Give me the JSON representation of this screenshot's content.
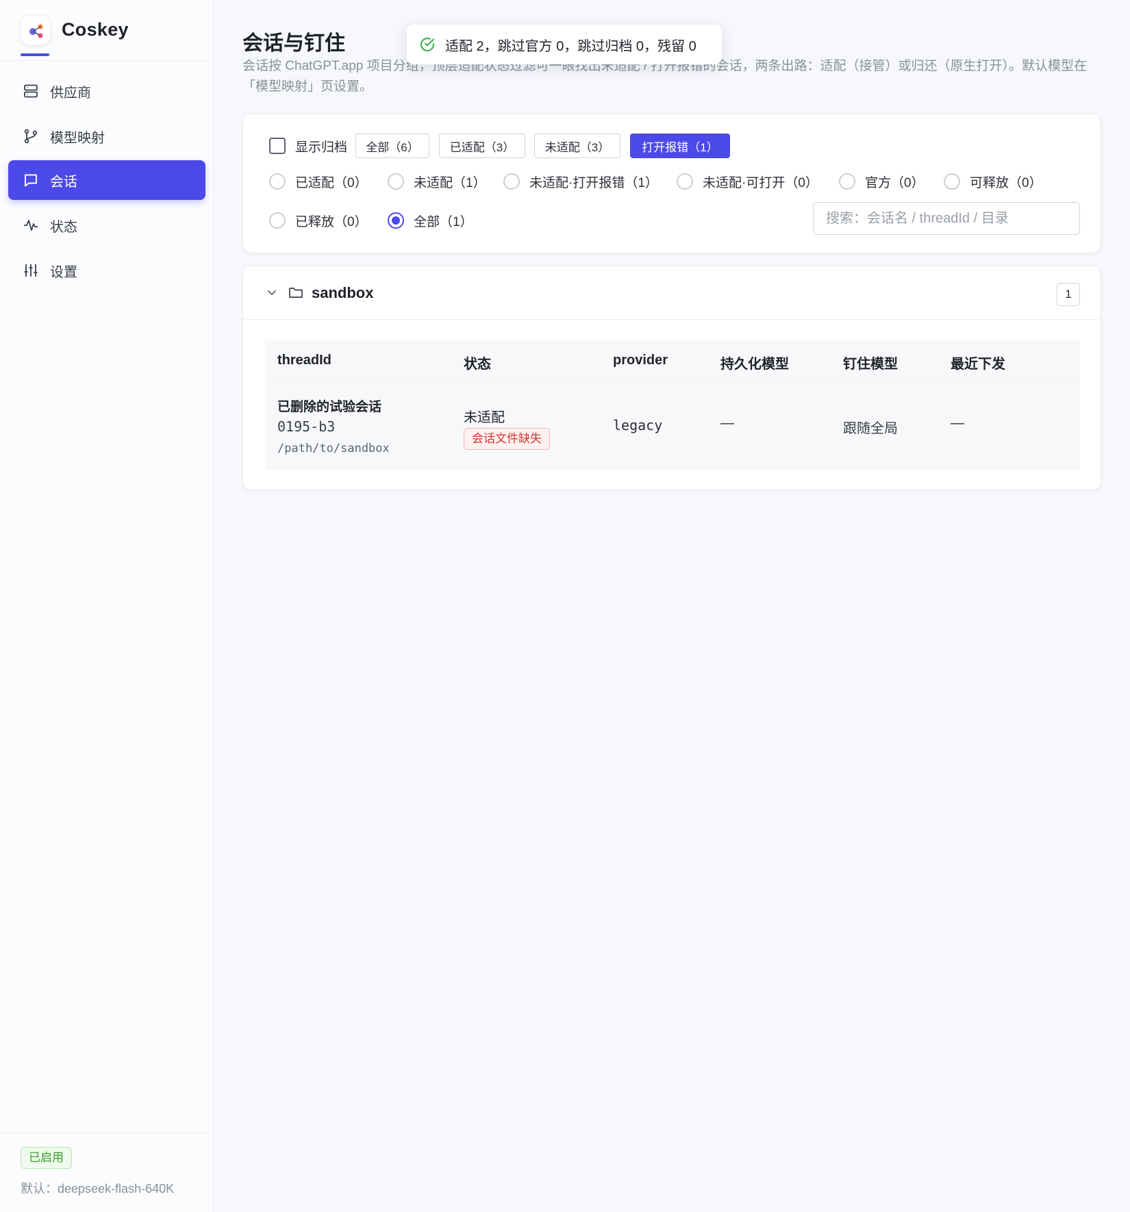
{
  "app": {
    "name": "Coskey"
  },
  "sidebar": {
    "items": [
      {
        "label": "供应商",
        "icon": "server-icon",
        "active": false
      },
      {
        "label": "模型映射",
        "icon": "branch-icon",
        "active": false
      },
      {
        "label": "会话",
        "icon": "message-icon",
        "active": true
      },
      {
        "label": "状态",
        "icon": "activity-icon",
        "active": false
      },
      {
        "label": "设置",
        "icon": "sliders-icon",
        "active": false
      }
    ],
    "footer": {
      "enabled_badge": "已启用",
      "default_model": "默认：deepseek-flash-640K"
    }
  },
  "toast": {
    "icon": "check-circle-icon",
    "message": "适配 2，跳过官方 0，跳过归档 0，残留 0"
  },
  "page": {
    "title": "会话与钉住",
    "description": "会话按 ChatGPT.app 项目分组，顶层适配状态过滤可一眼找出未适配 / 打开报错的会话，两条出路：适配（接管）或归还（原生打开）。默认模型在「模型映射」页设置。"
  },
  "filters": {
    "show_archived_label": "显示归档",
    "show_archived_checked": false,
    "chips": [
      {
        "label": "全部（6）",
        "active": false
      },
      {
        "label": "已适配（3）",
        "active": false
      },
      {
        "label": "未适配（3）",
        "active": false
      },
      {
        "label": "打开报错（1）",
        "active": true
      }
    ],
    "radios": [
      {
        "label": "已适配（0）",
        "checked": false
      },
      {
        "label": "未适配（1）",
        "checked": false
      },
      {
        "label": "未适配·打开报错（1）",
        "checked": false
      },
      {
        "label": "未适配·可打开（0）",
        "checked": false
      },
      {
        "label": "官方（0）",
        "checked": false
      },
      {
        "label": "可释放（0）",
        "checked": false
      },
      {
        "label": "已释放（0）",
        "checked": false
      },
      {
        "label": "全部（1）",
        "checked": true
      }
    ],
    "search_placeholder": "搜索：会话名 / threadId / 目录",
    "search_value": ""
  },
  "group": {
    "name": "sandbox",
    "count": "1",
    "expanded": true,
    "columns": [
      "threadId",
      "状态",
      "provider",
      "持久化模型",
      "钉住模型",
      "最近下发"
    ],
    "rows": [
      {
        "thread_name": "已删除的试验会话",
        "thread_id": "0195-b3",
        "path": "/path/to/sandbox",
        "status": "未适配",
        "status_tag": "会话文件缺失",
        "provider": "legacy",
        "persisted_model": "—",
        "pinned_model": "跟随全局",
        "recent": "—"
      }
    ]
  },
  "colors": {
    "accent": "#4b49e8",
    "success": "#3c9a2e",
    "danger": "#d4352c"
  }
}
